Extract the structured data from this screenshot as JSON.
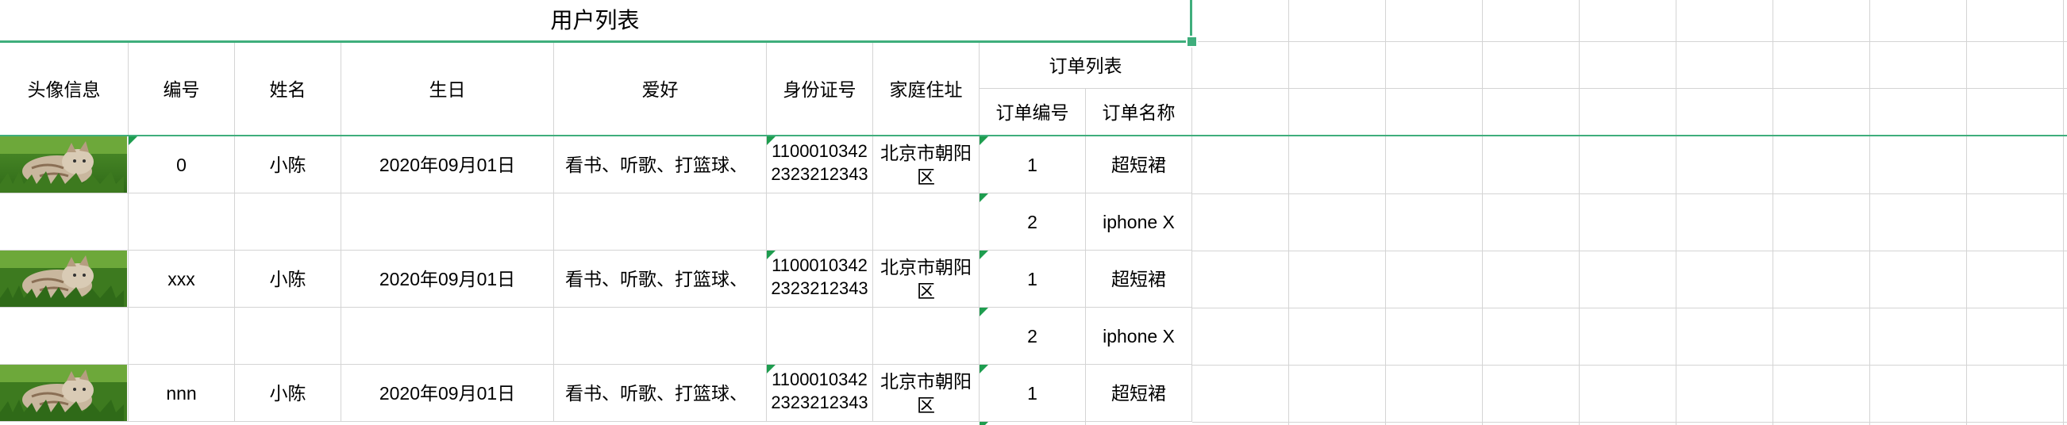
{
  "sheet": {
    "title": "用户列表",
    "headers": {
      "avatar": "头像信息",
      "id": "编号",
      "name": "姓名",
      "birthday": "生日",
      "hobby": "爱好",
      "id_card": "身份证号",
      "address": "家庭住址",
      "orders": "订单列表",
      "order_no": "订单编号",
      "order_name": "订单名称"
    },
    "users": [
      {
        "id": "0",
        "name": "小陈",
        "birthday": "2020年09月01日",
        "hobby": "看书、听歌、打篮球、",
        "id_card": "11000103422323212343",
        "address": "北京市朝阳区",
        "orders": [
          {
            "no": "1",
            "name": "超短裙"
          },
          {
            "no": "2",
            "name": "iphone X"
          }
        ]
      },
      {
        "id": "xxx",
        "name": "小陈",
        "birthday": "2020年09月01日",
        "hobby": "看书、听歌、打篮球、",
        "id_card": "11000103422323212343",
        "address": "北京市朝阳区",
        "orders": [
          {
            "no": "1",
            "name": "超短裙"
          },
          {
            "no": "2",
            "name": "iphone X"
          }
        ]
      },
      {
        "id": "nnn",
        "name": "小陈",
        "birthday": "2020年09月01日",
        "hobby": "看书、听歌、打篮球、",
        "id_card": "11000103422323212343",
        "address": "北京市朝阳区",
        "orders": [
          {
            "no": "1",
            "name": "超短裙"
          }
        ]
      }
    ],
    "colors": {
      "selection": "#3fae7c",
      "grid": "#d4d4d4",
      "comment_marker": "#1e9d4f"
    },
    "icons": {
      "avatar": "cat-photo-icon"
    }
  }
}
